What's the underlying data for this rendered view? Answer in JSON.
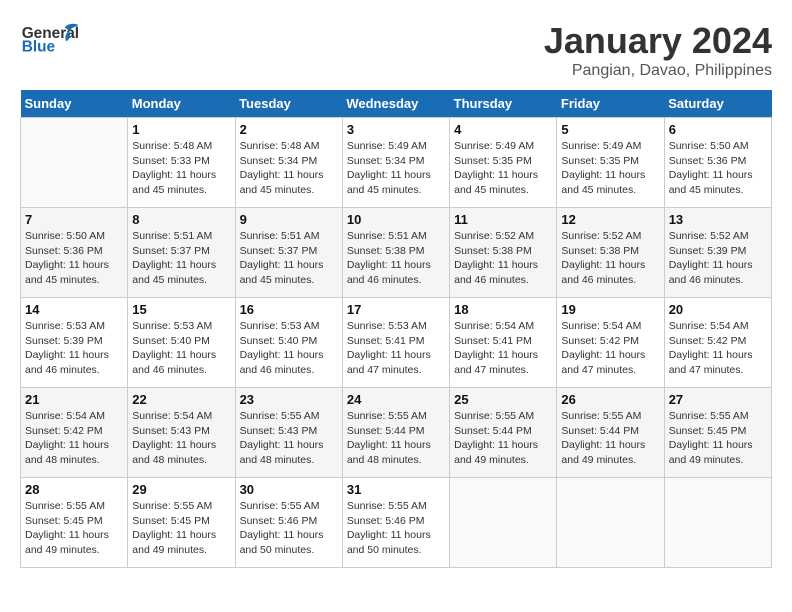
{
  "header": {
    "logo_line1": "General",
    "logo_line2": "Blue",
    "month": "January 2024",
    "location": "Pangian, Davao, Philippines"
  },
  "days_of_week": [
    "Sunday",
    "Monday",
    "Tuesday",
    "Wednesday",
    "Thursday",
    "Friday",
    "Saturday"
  ],
  "weeks": [
    [
      {
        "day": "",
        "info": ""
      },
      {
        "day": "1",
        "info": "Sunrise: 5:48 AM\nSunset: 5:33 PM\nDaylight: 11 hours\nand 45 minutes."
      },
      {
        "day": "2",
        "info": "Sunrise: 5:48 AM\nSunset: 5:34 PM\nDaylight: 11 hours\nand 45 minutes."
      },
      {
        "day": "3",
        "info": "Sunrise: 5:49 AM\nSunset: 5:34 PM\nDaylight: 11 hours\nand 45 minutes."
      },
      {
        "day": "4",
        "info": "Sunrise: 5:49 AM\nSunset: 5:35 PM\nDaylight: 11 hours\nand 45 minutes."
      },
      {
        "day": "5",
        "info": "Sunrise: 5:49 AM\nSunset: 5:35 PM\nDaylight: 11 hours\nand 45 minutes."
      },
      {
        "day": "6",
        "info": "Sunrise: 5:50 AM\nSunset: 5:36 PM\nDaylight: 11 hours\nand 45 minutes."
      }
    ],
    [
      {
        "day": "7",
        "info": "Sunrise: 5:50 AM\nSunset: 5:36 PM\nDaylight: 11 hours\nand 45 minutes."
      },
      {
        "day": "8",
        "info": "Sunrise: 5:51 AM\nSunset: 5:37 PM\nDaylight: 11 hours\nand 45 minutes."
      },
      {
        "day": "9",
        "info": "Sunrise: 5:51 AM\nSunset: 5:37 PM\nDaylight: 11 hours\nand 45 minutes."
      },
      {
        "day": "10",
        "info": "Sunrise: 5:51 AM\nSunset: 5:38 PM\nDaylight: 11 hours\nand 46 minutes."
      },
      {
        "day": "11",
        "info": "Sunrise: 5:52 AM\nSunset: 5:38 PM\nDaylight: 11 hours\nand 46 minutes."
      },
      {
        "day": "12",
        "info": "Sunrise: 5:52 AM\nSunset: 5:38 PM\nDaylight: 11 hours\nand 46 minutes."
      },
      {
        "day": "13",
        "info": "Sunrise: 5:52 AM\nSunset: 5:39 PM\nDaylight: 11 hours\nand 46 minutes."
      }
    ],
    [
      {
        "day": "14",
        "info": "Sunrise: 5:53 AM\nSunset: 5:39 PM\nDaylight: 11 hours\nand 46 minutes."
      },
      {
        "day": "15",
        "info": "Sunrise: 5:53 AM\nSunset: 5:40 PM\nDaylight: 11 hours\nand 46 minutes."
      },
      {
        "day": "16",
        "info": "Sunrise: 5:53 AM\nSunset: 5:40 PM\nDaylight: 11 hours\nand 46 minutes."
      },
      {
        "day": "17",
        "info": "Sunrise: 5:53 AM\nSunset: 5:41 PM\nDaylight: 11 hours\nand 47 minutes."
      },
      {
        "day": "18",
        "info": "Sunrise: 5:54 AM\nSunset: 5:41 PM\nDaylight: 11 hours\nand 47 minutes."
      },
      {
        "day": "19",
        "info": "Sunrise: 5:54 AM\nSunset: 5:42 PM\nDaylight: 11 hours\nand 47 minutes."
      },
      {
        "day": "20",
        "info": "Sunrise: 5:54 AM\nSunset: 5:42 PM\nDaylight: 11 hours\nand 47 minutes."
      }
    ],
    [
      {
        "day": "21",
        "info": "Sunrise: 5:54 AM\nSunset: 5:42 PM\nDaylight: 11 hours\nand 48 minutes."
      },
      {
        "day": "22",
        "info": "Sunrise: 5:54 AM\nSunset: 5:43 PM\nDaylight: 11 hours\nand 48 minutes."
      },
      {
        "day": "23",
        "info": "Sunrise: 5:55 AM\nSunset: 5:43 PM\nDaylight: 11 hours\nand 48 minutes."
      },
      {
        "day": "24",
        "info": "Sunrise: 5:55 AM\nSunset: 5:44 PM\nDaylight: 11 hours\nand 48 minutes."
      },
      {
        "day": "25",
        "info": "Sunrise: 5:55 AM\nSunset: 5:44 PM\nDaylight: 11 hours\nand 49 minutes."
      },
      {
        "day": "26",
        "info": "Sunrise: 5:55 AM\nSunset: 5:44 PM\nDaylight: 11 hours\nand 49 minutes."
      },
      {
        "day": "27",
        "info": "Sunrise: 5:55 AM\nSunset: 5:45 PM\nDaylight: 11 hours\nand 49 minutes."
      }
    ],
    [
      {
        "day": "28",
        "info": "Sunrise: 5:55 AM\nSunset: 5:45 PM\nDaylight: 11 hours\nand 49 minutes."
      },
      {
        "day": "29",
        "info": "Sunrise: 5:55 AM\nSunset: 5:45 PM\nDaylight: 11 hours\nand 49 minutes."
      },
      {
        "day": "30",
        "info": "Sunrise: 5:55 AM\nSunset: 5:46 PM\nDaylight: 11 hours\nand 50 minutes."
      },
      {
        "day": "31",
        "info": "Sunrise: 5:55 AM\nSunset: 5:46 PM\nDaylight: 11 hours\nand 50 minutes."
      },
      {
        "day": "",
        "info": ""
      },
      {
        "day": "",
        "info": ""
      },
      {
        "day": "",
        "info": ""
      }
    ]
  ]
}
